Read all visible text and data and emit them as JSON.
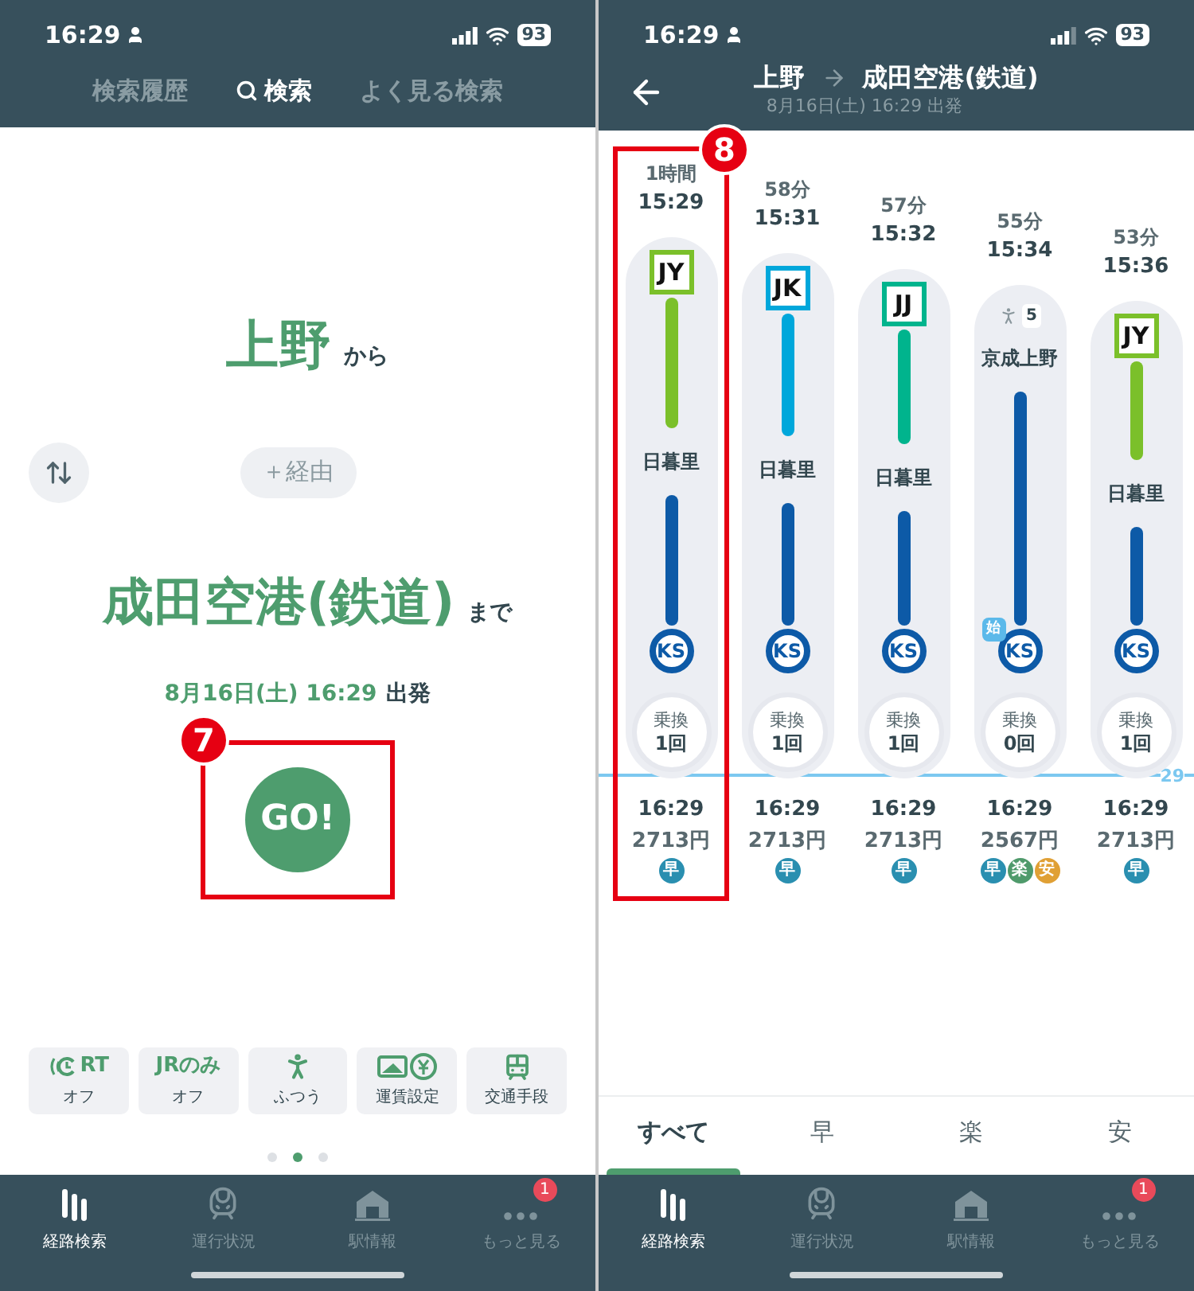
{
  "left": {
    "status": {
      "time": "16:29",
      "battery": "93"
    },
    "tabs": [
      {
        "label": "検索履歴",
        "selected": false,
        "search_icon": false
      },
      {
        "label": "検索",
        "selected": true,
        "search_icon": true
      },
      {
        "label": "よく見る検索",
        "selected": false,
        "search_icon": false
      }
    ],
    "from": {
      "station": "上野",
      "suffix": "から"
    },
    "via": "＋経由",
    "to": {
      "station": "成田空港(鉄道)",
      "suffix": "まで"
    },
    "datetime": {
      "value": "8月16日(土) 16:29",
      "suffix": "出発"
    },
    "go": "GO!",
    "callout": "7",
    "options": [
      {
        "kind": "rt",
        "title": "RT",
        "label": "オフ"
      },
      {
        "kind": "jr",
        "title": "JRのみ",
        "label": "オフ"
      },
      {
        "kind": "walk",
        "label": "ふつう"
      },
      {
        "kind": "fare",
        "label": "運賃設定"
      },
      {
        "kind": "transport",
        "label": "交通手段"
      }
    ],
    "pages": [
      {
        "selected": false
      },
      {
        "selected": true
      },
      {
        "selected": false
      }
    ],
    "nav": [
      {
        "kind": "route",
        "label": "経路検索",
        "selected": true
      },
      {
        "kind": "train",
        "label": "運行状況",
        "selected": false
      },
      {
        "kind": "station",
        "label": "駅情報",
        "selected": false
      },
      {
        "kind": "more",
        "label": "もっと見る",
        "selected": false,
        "badge": "1"
      }
    ]
  },
  "right": {
    "status": {
      "time": "16:29",
      "battery": "93"
    },
    "header": {
      "from": "上野",
      "to": "成田空港(鉄道)",
      "subtitle": "8月16日(土) 16:29 出発"
    },
    "callout": "8",
    "routes": [
      {
        "duration": "1時間",
        "depart": "15:29",
        "highlighted": true,
        "segments": [
          {
            "kind": "badge",
            "code": "JY",
            "color": "#7bc02a"
          },
          {
            "kind": "bar",
            "color": "#7bc02a"
          },
          {
            "kind": "station",
            "name": "日暮里"
          },
          {
            "kind": "bar",
            "color": "#0d5aa7"
          },
          {
            "kind": "end",
            "code": "KS"
          }
        ],
        "transfer": {
          "label": "乗換",
          "count": "1回"
        },
        "arrive": "16:29",
        "fare": "2713円",
        "tags": [
          {
            "label": "早",
            "color": "#2a8fb0"
          }
        ]
      },
      {
        "duration": "58分",
        "depart": "15:31",
        "highlighted": false,
        "segments": [
          {
            "kind": "badge",
            "code": "JK",
            "color": "#00a7db"
          },
          {
            "kind": "bar",
            "color": "#00a7db"
          },
          {
            "kind": "station",
            "name": "日暮里"
          },
          {
            "kind": "bar",
            "color": "#0d5aa7"
          },
          {
            "kind": "end",
            "code": "KS"
          }
        ],
        "transfer": {
          "label": "乗換",
          "count": "1回"
        },
        "arrive": "16:29",
        "fare": "2713円",
        "tags": [
          {
            "label": "早",
            "color": "#2a8fb0"
          }
        ]
      },
      {
        "duration": "57分",
        "depart": "15:32",
        "highlighted": false,
        "segments": [
          {
            "kind": "badge",
            "code": "JJ",
            "color": "#00b48d"
          },
          {
            "kind": "bar",
            "color": "#00b48d"
          },
          {
            "kind": "station",
            "name": "日暮里"
          },
          {
            "kind": "bar",
            "color": "#0d5aa7"
          },
          {
            "kind": "end",
            "code": "KS"
          }
        ],
        "transfer": {
          "label": "乗換",
          "count": "1回"
        },
        "arrive": "16:29",
        "fare": "2713円",
        "tags": [
          {
            "label": "早",
            "color": "#2a8fb0"
          }
        ]
      },
      {
        "duration": "55分",
        "depart": "15:34",
        "highlighted": false,
        "segments": [
          {
            "kind": "walk",
            "minutes": "5"
          },
          {
            "kind": "station",
            "name": "京成上野"
          },
          {
            "kind": "bar",
            "color": "#0d5aa7"
          },
          {
            "kind": "end",
            "code": "KS",
            "origin_mark": "始"
          }
        ],
        "transfer": {
          "label": "乗換",
          "count": "0回"
        },
        "arrive": "16:29",
        "fare": "2567円",
        "tags": [
          {
            "label": "早",
            "color": "#2a8fb0"
          },
          {
            "label": "楽",
            "color": "#4f9a6b"
          },
          {
            "label": "安",
            "color": "#e0a035"
          }
        ]
      },
      {
        "duration": "53分",
        "depart": "15:36",
        "highlighted": false,
        "segments": [
          {
            "kind": "badge",
            "code": "JY",
            "color": "#7bc02a"
          },
          {
            "kind": "bar",
            "color": "#7bc02a"
          },
          {
            "kind": "station",
            "name": "日暮里"
          },
          {
            "kind": "bar",
            "color": "#0d5aa7"
          },
          {
            "kind": "end",
            "code": "KS"
          }
        ],
        "transfer": {
          "label": "乗換",
          "count": "1回"
        },
        "arrive": "16:29",
        "fare": "2713円",
        "tags": [
          {
            "label": "早",
            "color": "#2a8fb0"
          }
        ]
      }
    ],
    "now_marker": "29",
    "filters": [
      {
        "label": "すべて",
        "selected": true
      },
      {
        "label": "早",
        "selected": false
      },
      {
        "label": "楽",
        "selected": false
      },
      {
        "label": "安",
        "selected": false
      }
    ],
    "nav": [
      {
        "kind": "route",
        "label": "経路検索",
        "selected": true
      },
      {
        "kind": "train",
        "label": "運行状況",
        "selected": false
      },
      {
        "kind": "station",
        "label": "駅情報",
        "selected": false
      },
      {
        "kind": "more",
        "label": "もっと見る",
        "selected": false,
        "badge": "1"
      }
    ]
  }
}
